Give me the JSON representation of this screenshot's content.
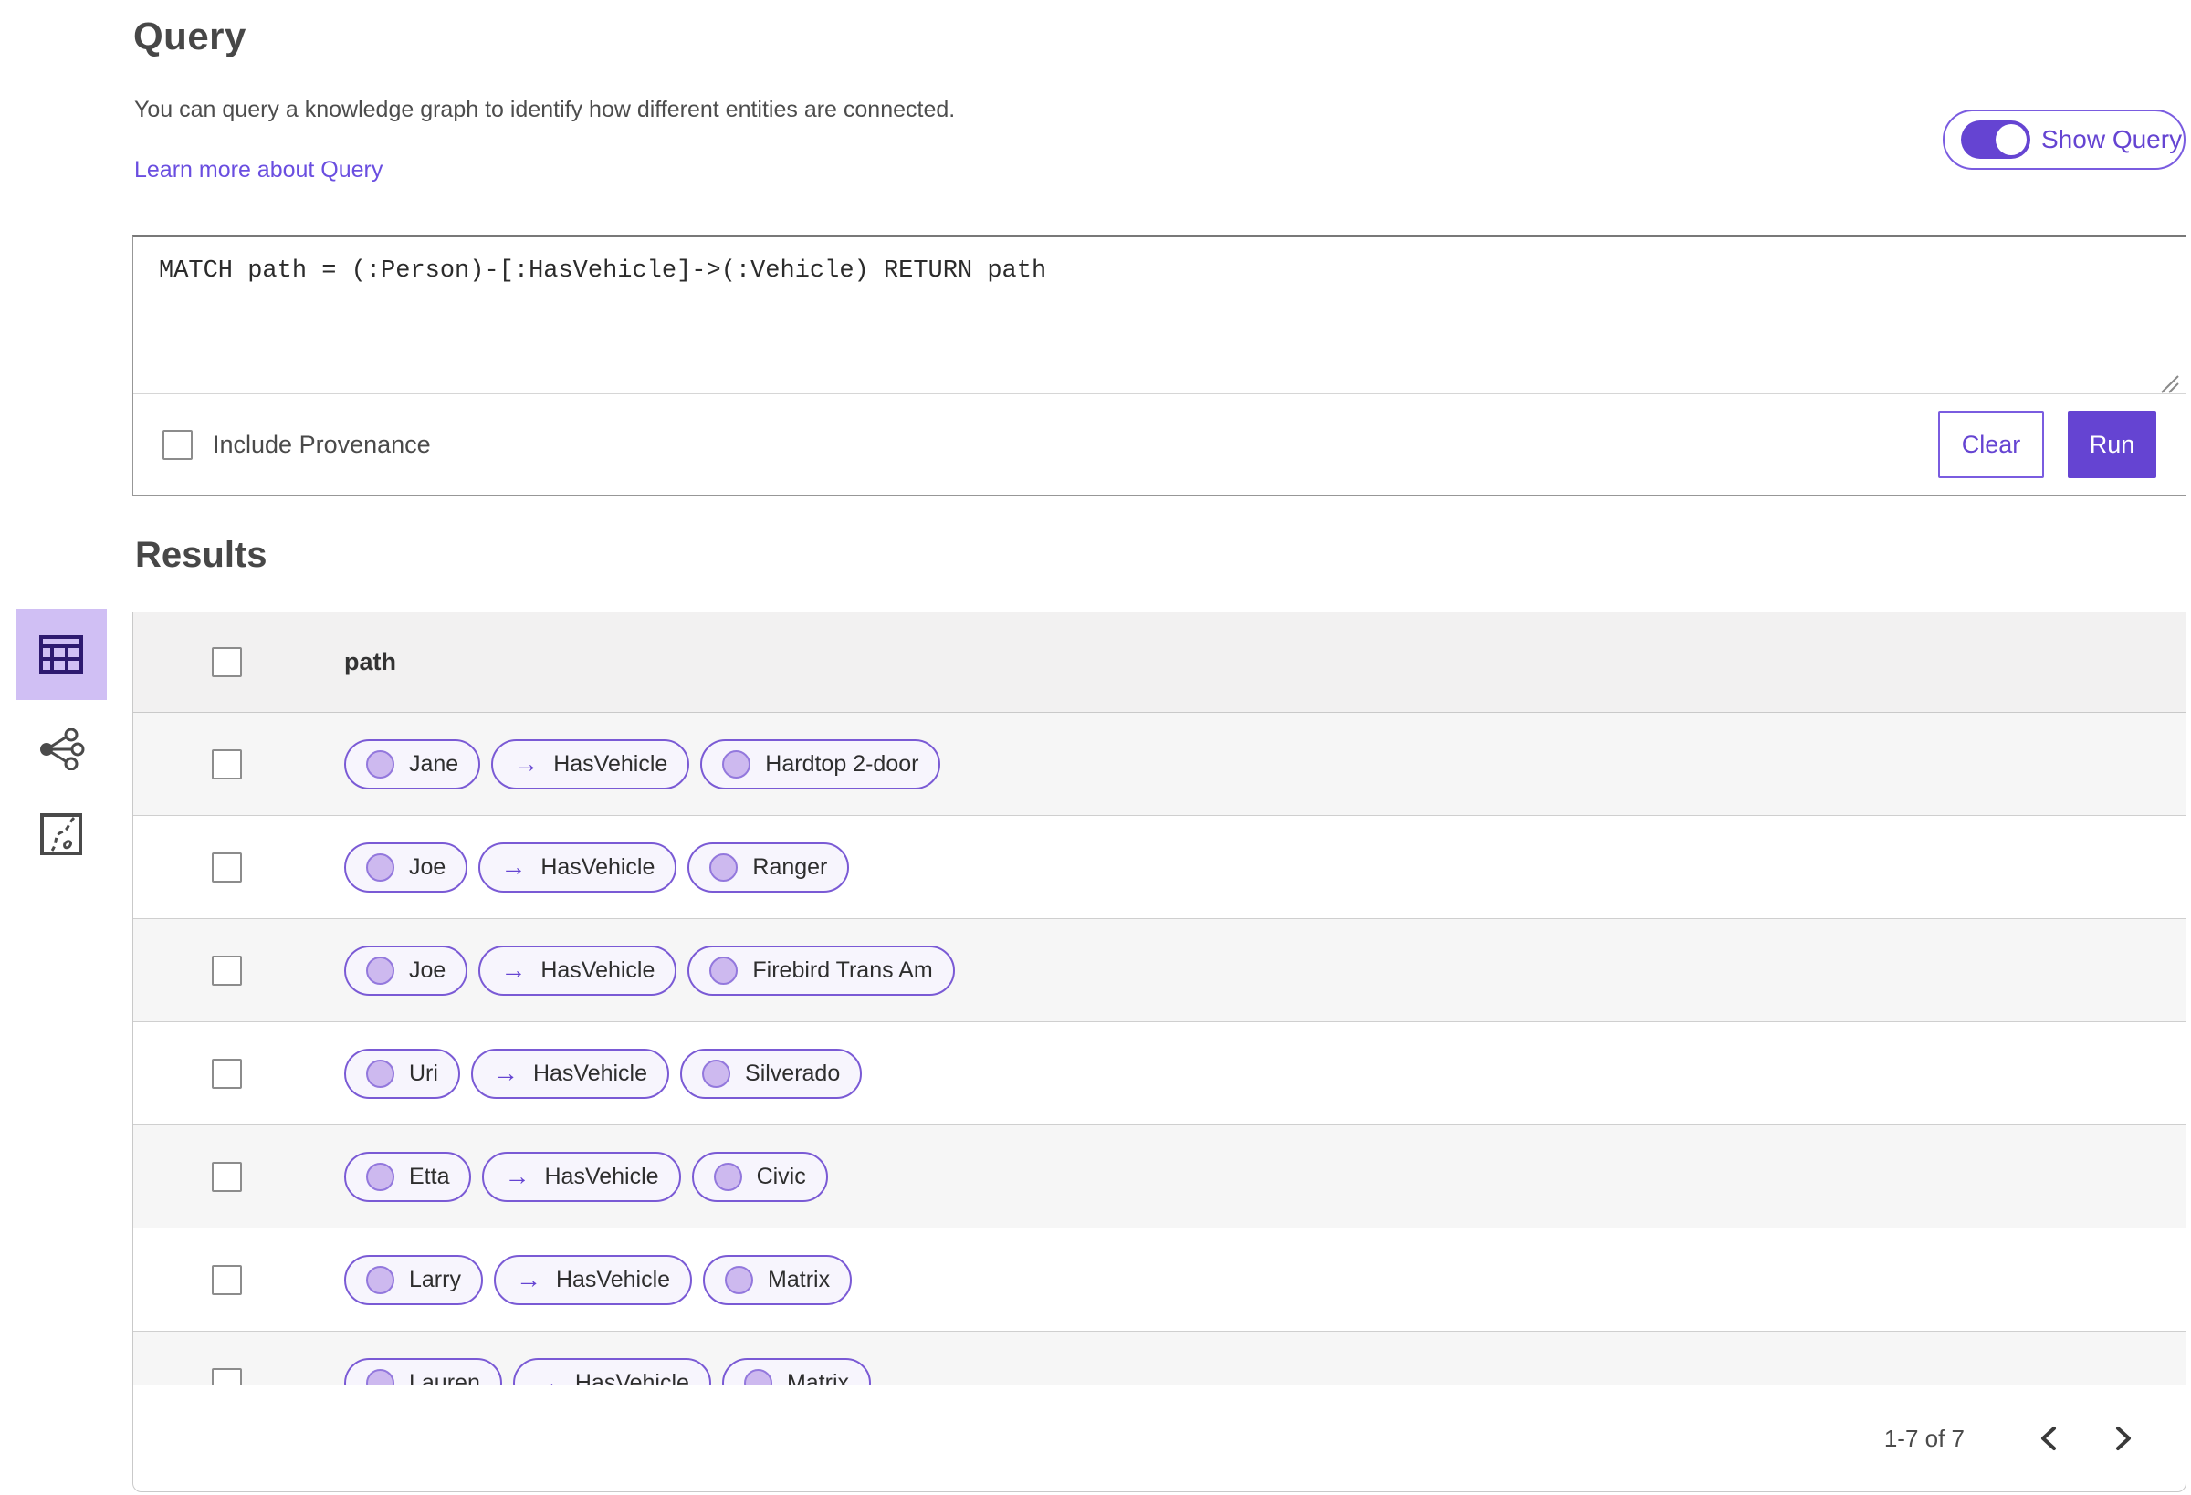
{
  "header": {
    "title": "Query",
    "description": "You can query a knowledge graph to identify how different entities are connected.",
    "learn_more_label": "Learn more about Query",
    "show_query_label": "Show Query",
    "show_query_on": true
  },
  "query_panel": {
    "query_text": "MATCH path = (:Person)-[:HasVehicle]->(:Vehicle) RETURN path",
    "include_provenance_label": "Include Provenance",
    "include_provenance_checked": false,
    "clear_label": "Clear",
    "run_label": "Run"
  },
  "results": {
    "title": "Results",
    "column_header": "path",
    "view_modes": [
      {
        "icon": "table-view-icon",
        "selected": true
      },
      {
        "icon": "link-chart-view-icon",
        "selected": false
      },
      {
        "icon": "map-view-icon",
        "selected": false
      }
    ],
    "rows": [
      {
        "entity": "Jane",
        "relation": "HasVehicle",
        "target": "Hardtop 2-door"
      },
      {
        "entity": "Joe",
        "relation": "HasVehicle",
        "target": "Ranger"
      },
      {
        "entity": "Joe",
        "relation": "HasVehicle",
        "target": "Firebird Trans Am"
      },
      {
        "entity": "Uri",
        "relation": "HasVehicle",
        "target": "Silverado"
      },
      {
        "entity": "Etta",
        "relation": "HasVehicle",
        "target": "Civic"
      },
      {
        "entity": "Larry",
        "relation": "HasVehicle",
        "target": "Matrix"
      },
      {
        "entity": "Lauren",
        "relation": "HasVehicle",
        "target": "Matrix"
      }
    ],
    "pagination": {
      "range_label": "1-7 of 7"
    }
  },
  "colors": {
    "accent": "#6544d2",
    "accent_border": "#7a5ce0",
    "chip_border": "#7a5ad5",
    "chip_bg": "#f7f5fd",
    "chip_dot": "#cdb9ef",
    "selected_tile_bg": "#d0bff4",
    "header_row_bg": "#f2f1f1",
    "alt_row_bg": "#f6f6f6"
  }
}
